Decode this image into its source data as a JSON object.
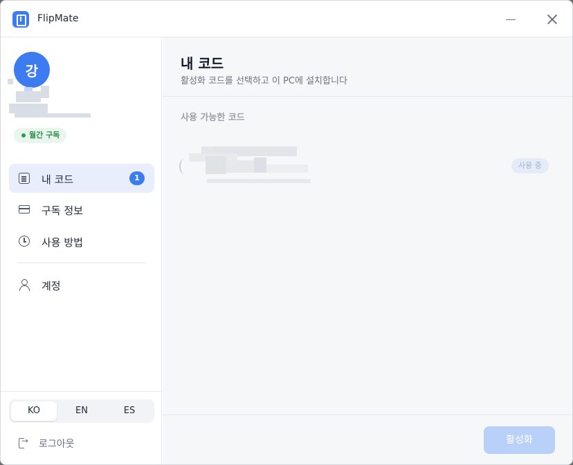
{
  "window": {
    "title": "FlipMate"
  },
  "sidebar": {
    "avatar_initial": "강",
    "subscription_badge": "월간 구독",
    "nav": [
      {
        "label": "내 코드",
        "icon": "document-icon",
        "count": "1",
        "active": true
      },
      {
        "label": "구독 정보",
        "icon": "credit-card-icon"
      },
      {
        "label": "사용 방법",
        "icon": "clock-icon"
      },
      {
        "label": "계정",
        "icon": "user-icon"
      }
    ],
    "languages": [
      "KO",
      "EN",
      "ES"
    ],
    "selected_language": "KO",
    "logout_label": "로그아웃"
  },
  "main": {
    "title": "내 코드",
    "subtitle": "활성화 코드를 선택하고 이 PC에 설치합니다",
    "section_label": "사용 가능한 코드",
    "code_item": {
      "status": "사용 중"
    },
    "activate_label": "활성화"
  },
  "colors": {
    "accent": "#3d7bf0",
    "nav_active_bg": "#e8eefc",
    "badge_green": "#22a150",
    "disabled_button": "#b9d0f8"
  }
}
